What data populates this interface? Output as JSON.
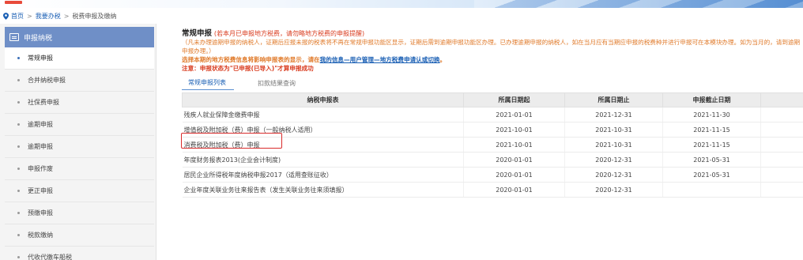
{
  "breadcrumb": {
    "items": [
      {
        "label": "首页"
      },
      {
        "label": "我要办税"
      },
      {
        "label": "税费申报及缴纳"
      }
    ],
    "separator": ">"
  },
  "sidebar": {
    "header_label": "申报纳税",
    "items": [
      {
        "label": "常规申报",
        "active": true
      },
      {
        "label": "合并纳税申报"
      },
      {
        "label": "社保费申报"
      },
      {
        "label": "逾期申报"
      },
      {
        "label": "逾期申报"
      },
      {
        "label": "申报作废"
      },
      {
        "label": "更正申报"
      },
      {
        "label": "预缴申报"
      },
      {
        "label": "税款缴纳"
      },
      {
        "label": "代收代缴车船税"
      }
    ]
  },
  "notice": {
    "title": "常规申报",
    "title_note": "(若本月已申报地方税费，请勿略地方税费的申报提醒)",
    "body": "（凡未办理逾期申报的纳税人，证期后应报未报的税表将不再在常规申报功能区显示，证期后需到逾期申报功能区办理。已办理逾期申报的纳税人，如在当月应有当期应申报的税费种并进行申报可在本模块办理。如为当月的，请到逾期申报办理。）",
    "select_line_prefix": "选择本期的地方税费信息将影响申报表的显示，请在",
    "select_line_link": "我的信息—用户管理—地方税费申请认或切换",
    "select_line_suffix": "。",
    "note": "注意：申报状态为\"已申报(已导入)\"才算申报成功"
  },
  "tabs": [
    {
      "label": "常规申报列表",
      "active": true
    },
    {
      "label": "扣款结果查询",
      "active": false
    }
  ],
  "table": {
    "headers": [
      "纳税申报表",
      "所属日期起",
      "所属日期止",
      "申报截止日期",
      ""
    ],
    "rows": [
      {
        "name": "残疾人就业保障金缴费申报",
        "start": "2021-01-01",
        "end": "2021-12-31",
        "deadline": "2021-11-30"
      },
      {
        "name": "增值税及附加税（费）申报（一般纳税人适用）",
        "start": "2021-10-01",
        "end": "2021-10-31",
        "deadline": "2021-11-15"
      },
      {
        "name": "消费税及附加税（费）申报",
        "start": "2021-10-01",
        "end": "2021-10-31",
        "deadline": "2021-11-15"
      },
      {
        "name": "年度财务报表2013(企业会计制度)",
        "start": "2020-01-01",
        "end": "2020-12-31",
        "deadline": "2021-05-31"
      },
      {
        "name": "居民企业所得税年度纳税申报2017（适用查账征收）",
        "start": "2020-01-01",
        "end": "2020-12-31",
        "deadline": "2021-05-31"
      },
      {
        "name": "企业年度关联业务往来报告表（发生关联业务往来须填报）",
        "start": "2020-01-01",
        "end": "2020-12-31",
        "deadline": ""
      }
    ]
  },
  "colors": {
    "accent_blue": "#6f8fc7",
    "link_blue": "#1a5fb4",
    "warning_orange": "#e07a2a",
    "alert_red": "#d93b1e",
    "highlight_red": "#d92b2b"
  },
  "icons": {
    "breadcrumb": "location-pin-icon",
    "sidebar_header": "list-icon"
  }
}
